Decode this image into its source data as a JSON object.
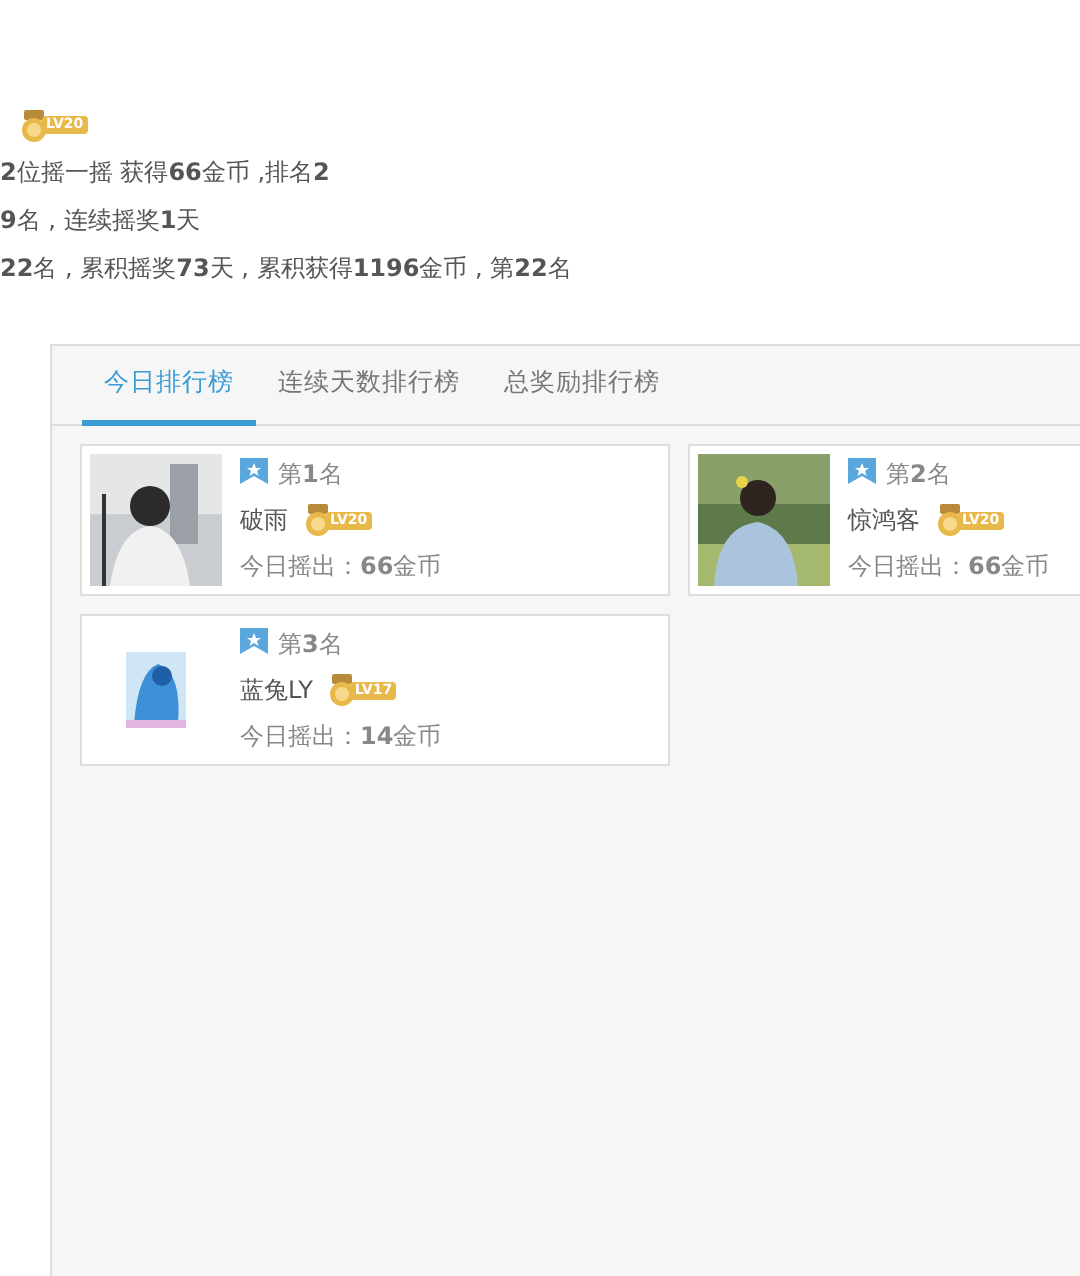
{
  "header": {
    "level": "LV20"
  },
  "summary_lines": [
    "**2**位摇一摇 获得**66**金币 ,排名**2**",
    "**9**名 , 连续摇奖**1**天",
    "**22**名 , 累积摇奖**73**天 , 累积获得**1196**金币 , 第**22**名"
  ],
  "tabs": [
    {
      "label": "今日排行榜",
      "selected": true
    },
    {
      "label": "连续天数排行榜",
      "selected": false
    },
    {
      "label": "总奖励排行榜",
      "selected": false
    }
  ],
  "entries": [
    {
      "rank": "第**1**名",
      "name": "破雨",
      "level": "LV20",
      "amount": "今日摇出：**66**金币"
    },
    {
      "rank": "第**2**名",
      "name": "惊鸿客",
      "level": "LV20",
      "amount": "今日摇出：**66**金币"
    },
    {
      "rank": "第**3**名",
      "name": "蓝兔LY",
      "level": "LV17",
      "amount": "今日摇出：**14**金币"
    }
  ]
}
